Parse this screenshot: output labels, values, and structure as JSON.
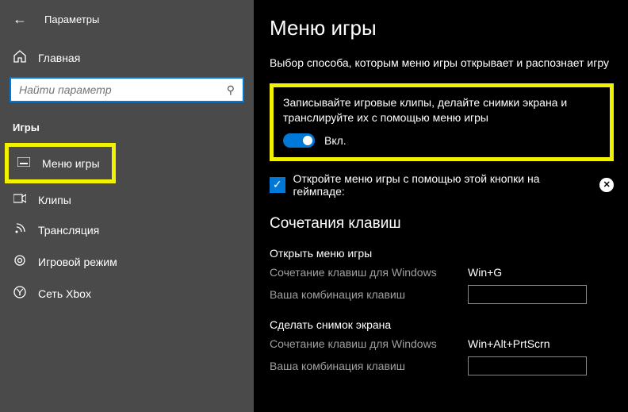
{
  "titlebar": {
    "title": "Параметры"
  },
  "sidebar": {
    "home": "Главная",
    "search_placeholder": "Найти параметр",
    "category": "Игры",
    "items": [
      {
        "label": "Меню игры"
      },
      {
        "label": "Клипы"
      },
      {
        "label": "Трансляция"
      },
      {
        "label": "Игровой режим"
      },
      {
        "label": "Сеть Xbox"
      }
    ]
  },
  "content": {
    "heading": "Меню игры",
    "subheading": "Выбор способа, которым меню игры открывает и распознает игру",
    "panel_desc": "Записывайте игровые клипы, делайте снимки экрана и транслируйте их с помощью меню игры",
    "toggle_label": "Вкл.",
    "checkbox_label": "Откройте меню игры с помощью этой кнопки на геймпаде:",
    "shortcuts_heading": "Сочетания клавиш",
    "groups": [
      {
        "title": "Открыть меню игры",
        "win_label": "Сочетание клавиш для Windows",
        "win_value": "Win+G",
        "user_label": "Ваша комбинация клавиш"
      },
      {
        "title": "Сделать снимок экрана",
        "win_label": "Сочетание клавиш для Windows",
        "win_value": "Win+Alt+PrtScrn",
        "user_label": "Ваша комбинация клавиш"
      }
    ]
  }
}
